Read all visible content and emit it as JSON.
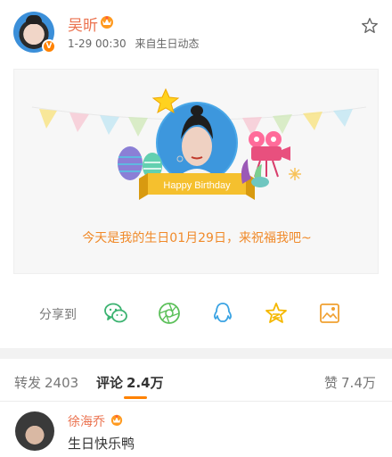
{
  "post": {
    "author": "吴昕",
    "time": "1-29 00:30",
    "source": "来自生日动态",
    "card": {
      "badge_text": "Happy Birthday",
      "message": "今天是我的生日01月29日，来祝福我吧~"
    }
  },
  "share": {
    "label": "分享到",
    "targets": [
      "wechat-icon",
      "moments-icon",
      "qq-icon",
      "qzone-icon",
      "save-image-icon"
    ]
  },
  "tabs": {
    "repost": {
      "label": "转发",
      "count": "2403"
    },
    "comment": {
      "label": "评论",
      "count": "2.4万"
    },
    "like": {
      "label": "赞",
      "count": "7.4万"
    }
  },
  "comment": {
    "author": "徐海乔",
    "text": "生日快乐鸭"
  },
  "colors": {
    "accent": "#ff8200",
    "name": "#eb7350",
    "share_green": "#3cb371",
    "share_blue": "#3aa3e3",
    "share_yellow": "#f5b800"
  }
}
